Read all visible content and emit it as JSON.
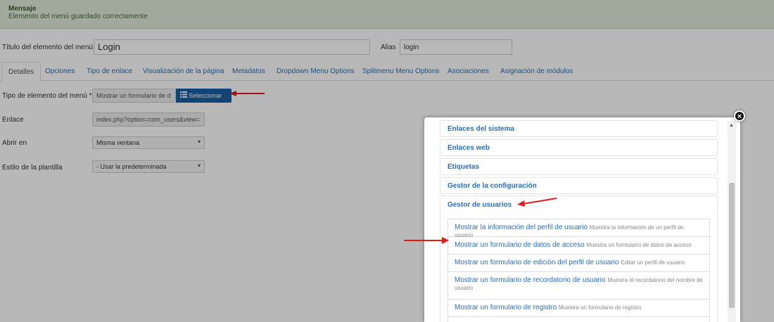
{
  "message": {
    "heading": "Mensaje",
    "body": "Elemento del menú guardado correctamente"
  },
  "form": {
    "title_label": "Título del elemento del menú *",
    "title_value": "Login",
    "alias_label": "Alias",
    "alias_value": "login"
  },
  "tabs": [
    {
      "label": "Detalles"
    },
    {
      "label": "Opciones"
    },
    {
      "label": "Tipo de enlace"
    },
    {
      "label": "Visualización de la página"
    },
    {
      "label": "Metadatos"
    },
    {
      "label": "Dropdown Menu Options"
    },
    {
      "label": "Splitmenu Menu Options"
    },
    {
      "label": "Asociaciones"
    },
    {
      "label": "Asignación de módulos"
    }
  ],
  "fields": {
    "type_label": "Tipo de elemento del menú *",
    "type_value": "Mostrar un formulario de d",
    "select_button": "Seleccionar",
    "link_label": "Enlace",
    "link_value": "index.php?option=com_users&view=",
    "open_label": "Abrir en",
    "open_value": "Misma ventana",
    "style_label": "Estilo de la plantilla",
    "style_value": "- Usar la predeterminada"
  },
  "modal": {
    "close_symbol": "×",
    "groups": [
      {
        "label": "Enlaces del sistema"
      },
      {
        "label": "Enlaces web"
      },
      {
        "label": "Etiquetas"
      },
      {
        "label": "Gestor de la configuración"
      },
      {
        "label": "Gestor de usuarios"
      }
    ],
    "items": [
      {
        "title": "Mostrar la información del perfil de usuario",
        "desc": "Muestra la información de un perfil de usuario"
      },
      {
        "title": "Mostrar un formulario de datos de acceso",
        "desc": "Muestra un formulario de datos de acceso"
      },
      {
        "title": "Mostrar un formulario de edición del perfil de usuario",
        "desc": "Editar un perfil de usuario"
      },
      {
        "title": "Mostrar un formulario de recordatorio de usuario",
        "desc": "Muestra el recordatorio del nombre de usuario"
      },
      {
        "title": "Mostrar un formulario de registro",
        "desc": "Muestra un formulario de registro"
      }
    ]
  },
  "colors": {
    "accent": "#2a6fb5",
    "button": "#1d5ea3",
    "arrow": "#e01b1b",
    "alert_bg": "#dfe9d8"
  }
}
